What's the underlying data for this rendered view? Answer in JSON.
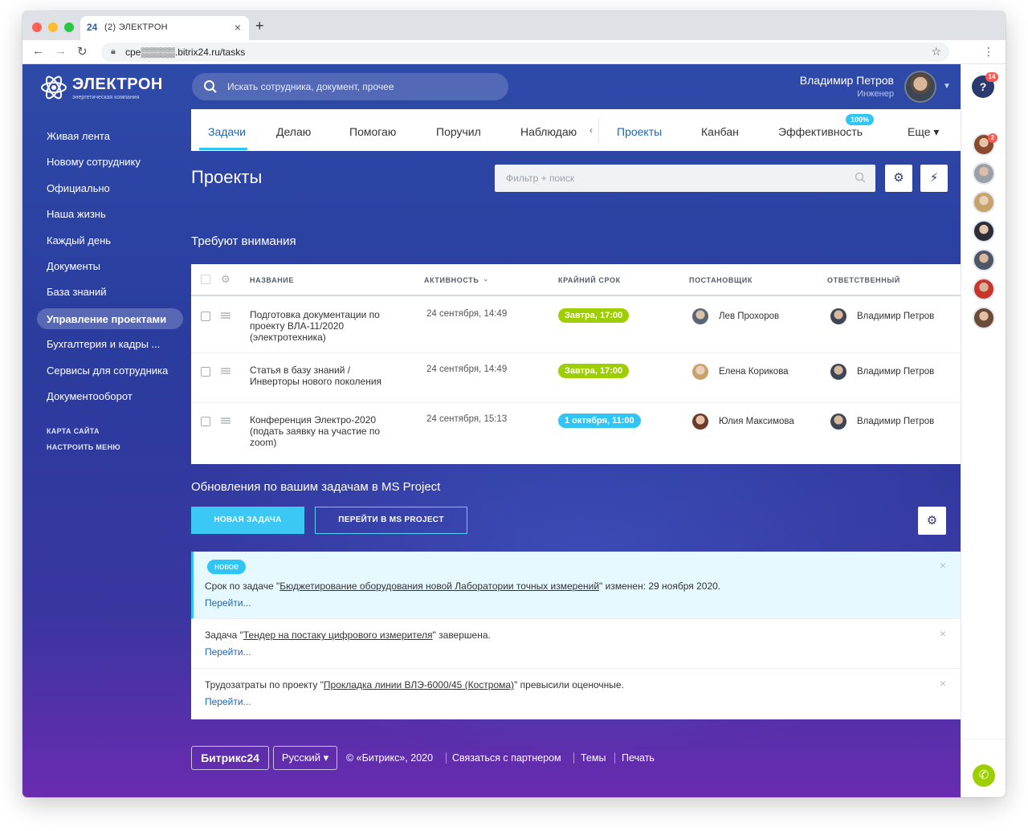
{
  "browser": {
    "tab_favicon": "24",
    "tab_title": "(2) ЭЛЕКТРОН",
    "tab_close": "×",
    "new_tab": "+",
    "url": "cpe▒▒▒▒▒.bitrix24.ru/tasks"
  },
  "logo": {
    "title": "ЭЛЕКТРОН",
    "subtitle": "энергетическая компания"
  },
  "sidebar": {
    "items": [
      {
        "label": "Живая лента"
      },
      {
        "label": "Новому сотруднику"
      },
      {
        "label": "Официально"
      },
      {
        "label": "Наша жизнь"
      },
      {
        "label": "Каждый день"
      },
      {
        "label": "Документы"
      },
      {
        "label": "База знаний"
      },
      {
        "label": "Управление проектами",
        "active": true
      },
      {
        "label": "Бухгалтерия и кадры ..."
      },
      {
        "label": "Сервисы для сотрудника"
      },
      {
        "label": "Документооборот"
      }
    ],
    "sitemap": "КАРТА САЙТА",
    "configure_menu": "НАСТРОИТЬ МЕНЮ"
  },
  "header": {
    "search_placeholder": "Искать сотрудника, документ, прочее",
    "user_name": "Владимир Петров",
    "user_role": "Инженер"
  },
  "rail": {
    "help_label": "?",
    "help_badge": "14",
    "avatar_badge": "2"
  },
  "tabs": {
    "items": [
      "Задачи",
      "Делаю",
      "Помогаю",
      "Поручил",
      "Наблюдаю",
      "Проекты",
      "Канбан",
      "Эффективность",
      "Еще ▾"
    ],
    "efficiency_badge": "100%"
  },
  "page": {
    "title": "Проекты",
    "filter_placeholder": "Фильтр + поиск",
    "attention_title": "Требуют внимания"
  },
  "table": {
    "headers": {
      "name": "НАЗВАНИЕ",
      "activity": "АКТИВНОСТЬ",
      "deadline": "КРАЙНИЙ СРОК",
      "creator": "ПОСТАНОВЩИК",
      "responsible": "ОТВЕТСТВЕННЫЙ"
    },
    "rows": [
      {
        "name": "Подготовка документации по проекту ВЛА-11/2020 (электротехника)",
        "activity": "24 сентября, 14:49",
        "deadline": "Завтра, 17:00",
        "deadline_color": "#9dcf00",
        "creator": "Лев Прохоров",
        "responsible": "Владимир Петров"
      },
      {
        "name": "Статья в базу знаний / Инверторы нового поколения",
        "activity": "24 сентября, 14:49",
        "deadline": "Завтра, 17:00",
        "deadline_color": "#9dcf00",
        "creator": "Елена Корикова",
        "responsible": "Владимир Петров"
      },
      {
        "name": "Конференция Электро-2020 (подать заявку на участие по zoom)",
        "activity": "24 сентября, 15:13",
        "deadline": "1 октября, 11:00",
        "deadline_color": "#2fc6f6",
        "creator": "Юлия Максимова",
        "responsible": "Владимир Петров"
      }
    ]
  },
  "updates": {
    "title": "Обновления по вашим задачам в MS Project",
    "new_task_button": "НОВАЯ ЗАДАЧА",
    "ms_project_button": "ПЕРЕЙТИ В MS PROJECT",
    "go_label": "Перейти...",
    "new_badge": "новое",
    "notices": [
      {
        "prefix": "Срок по задаче \"",
        "link": "Бюджетирование оборудования новой Лаборатории точных измерений",
        "suffix": "\" изменен: 29 ноября 2020."
      },
      {
        "prefix": "Задача \"",
        "link": "Тендер на постаку цифрового измерителя",
        "suffix": "\" завершена."
      },
      {
        "prefix": "Трудозатраты по проекту \"",
        "link": "Прокладка линии ВЛЭ-6000/45 (Кострома)",
        "suffix": "\" превысили оценочные."
      }
    ]
  },
  "footer": {
    "logo": "Битрикс24",
    "language": "Русский ▾",
    "copyright": "© «Битрикс», 2020",
    "partner": "Связаться с партнером",
    "themes": "Темы",
    "print": "Печать"
  }
}
